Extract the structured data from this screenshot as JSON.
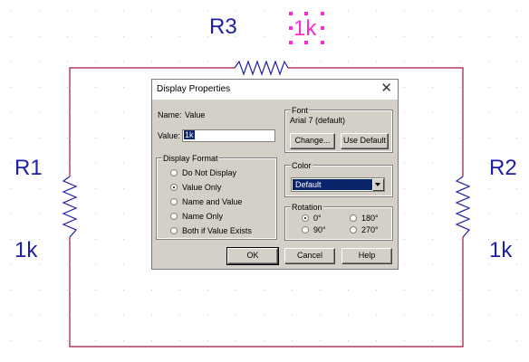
{
  "schematic": {
    "r1": {
      "name": "R1",
      "value": "1k"
    },
    "r2": {
      "name": "R2",
      "value": "1k"
    },
    "r3": {
      "name": "R3",
      "value": "1k"
    },
    "wire_color": "#a3153a",
    "resistor_color": "#1f1fa3",
    "selection_color": "#ff2bd6"
  },
  "dialog": {
    "title": "Display Properties",
    "name_label": "Name:",
    "name_value": "Value",
    "value_label": "Value:",
    "value_input": "1k",
    "font_group": {
      "title": "Font",
      "current": "Arial 7 (default)",
      "change_button": "Change...",
      "use_default_button": "Use Default"
    },
    "display_format": {
      "title": "Display Format",
      "options": [
        {
          "label": "Do Not Display",
          "checked": false
        },
        {
          "label": "Value Only",
          "checked": true
        },
        {
          "label": "Name and Value",
          "checked": false
        },
        {
          "label": "Name Only",
          "checked": false
        },
        {
          "label": "Both if Value Exists",
          "checked": false
        }
      ]
    },
    "color_group": {
      "title": "Color",
      "selected": "Default"
    },
    "rotation_group": {
      "title": "Rotation",
      "options": [
        {
          "label": "0°",
          "checked": true
        },
        {
          "label": "180°",
          "checked": false
        },
        {
          "label": "90°",
          "checked": false
        },
        {
          "label": "270°",
          "checked": false
        }
      ]
    },
    "buttons": {
      "ok": "OK",
      "cancel": "Cancel",
      "help": "Help"
    }
  }
}
